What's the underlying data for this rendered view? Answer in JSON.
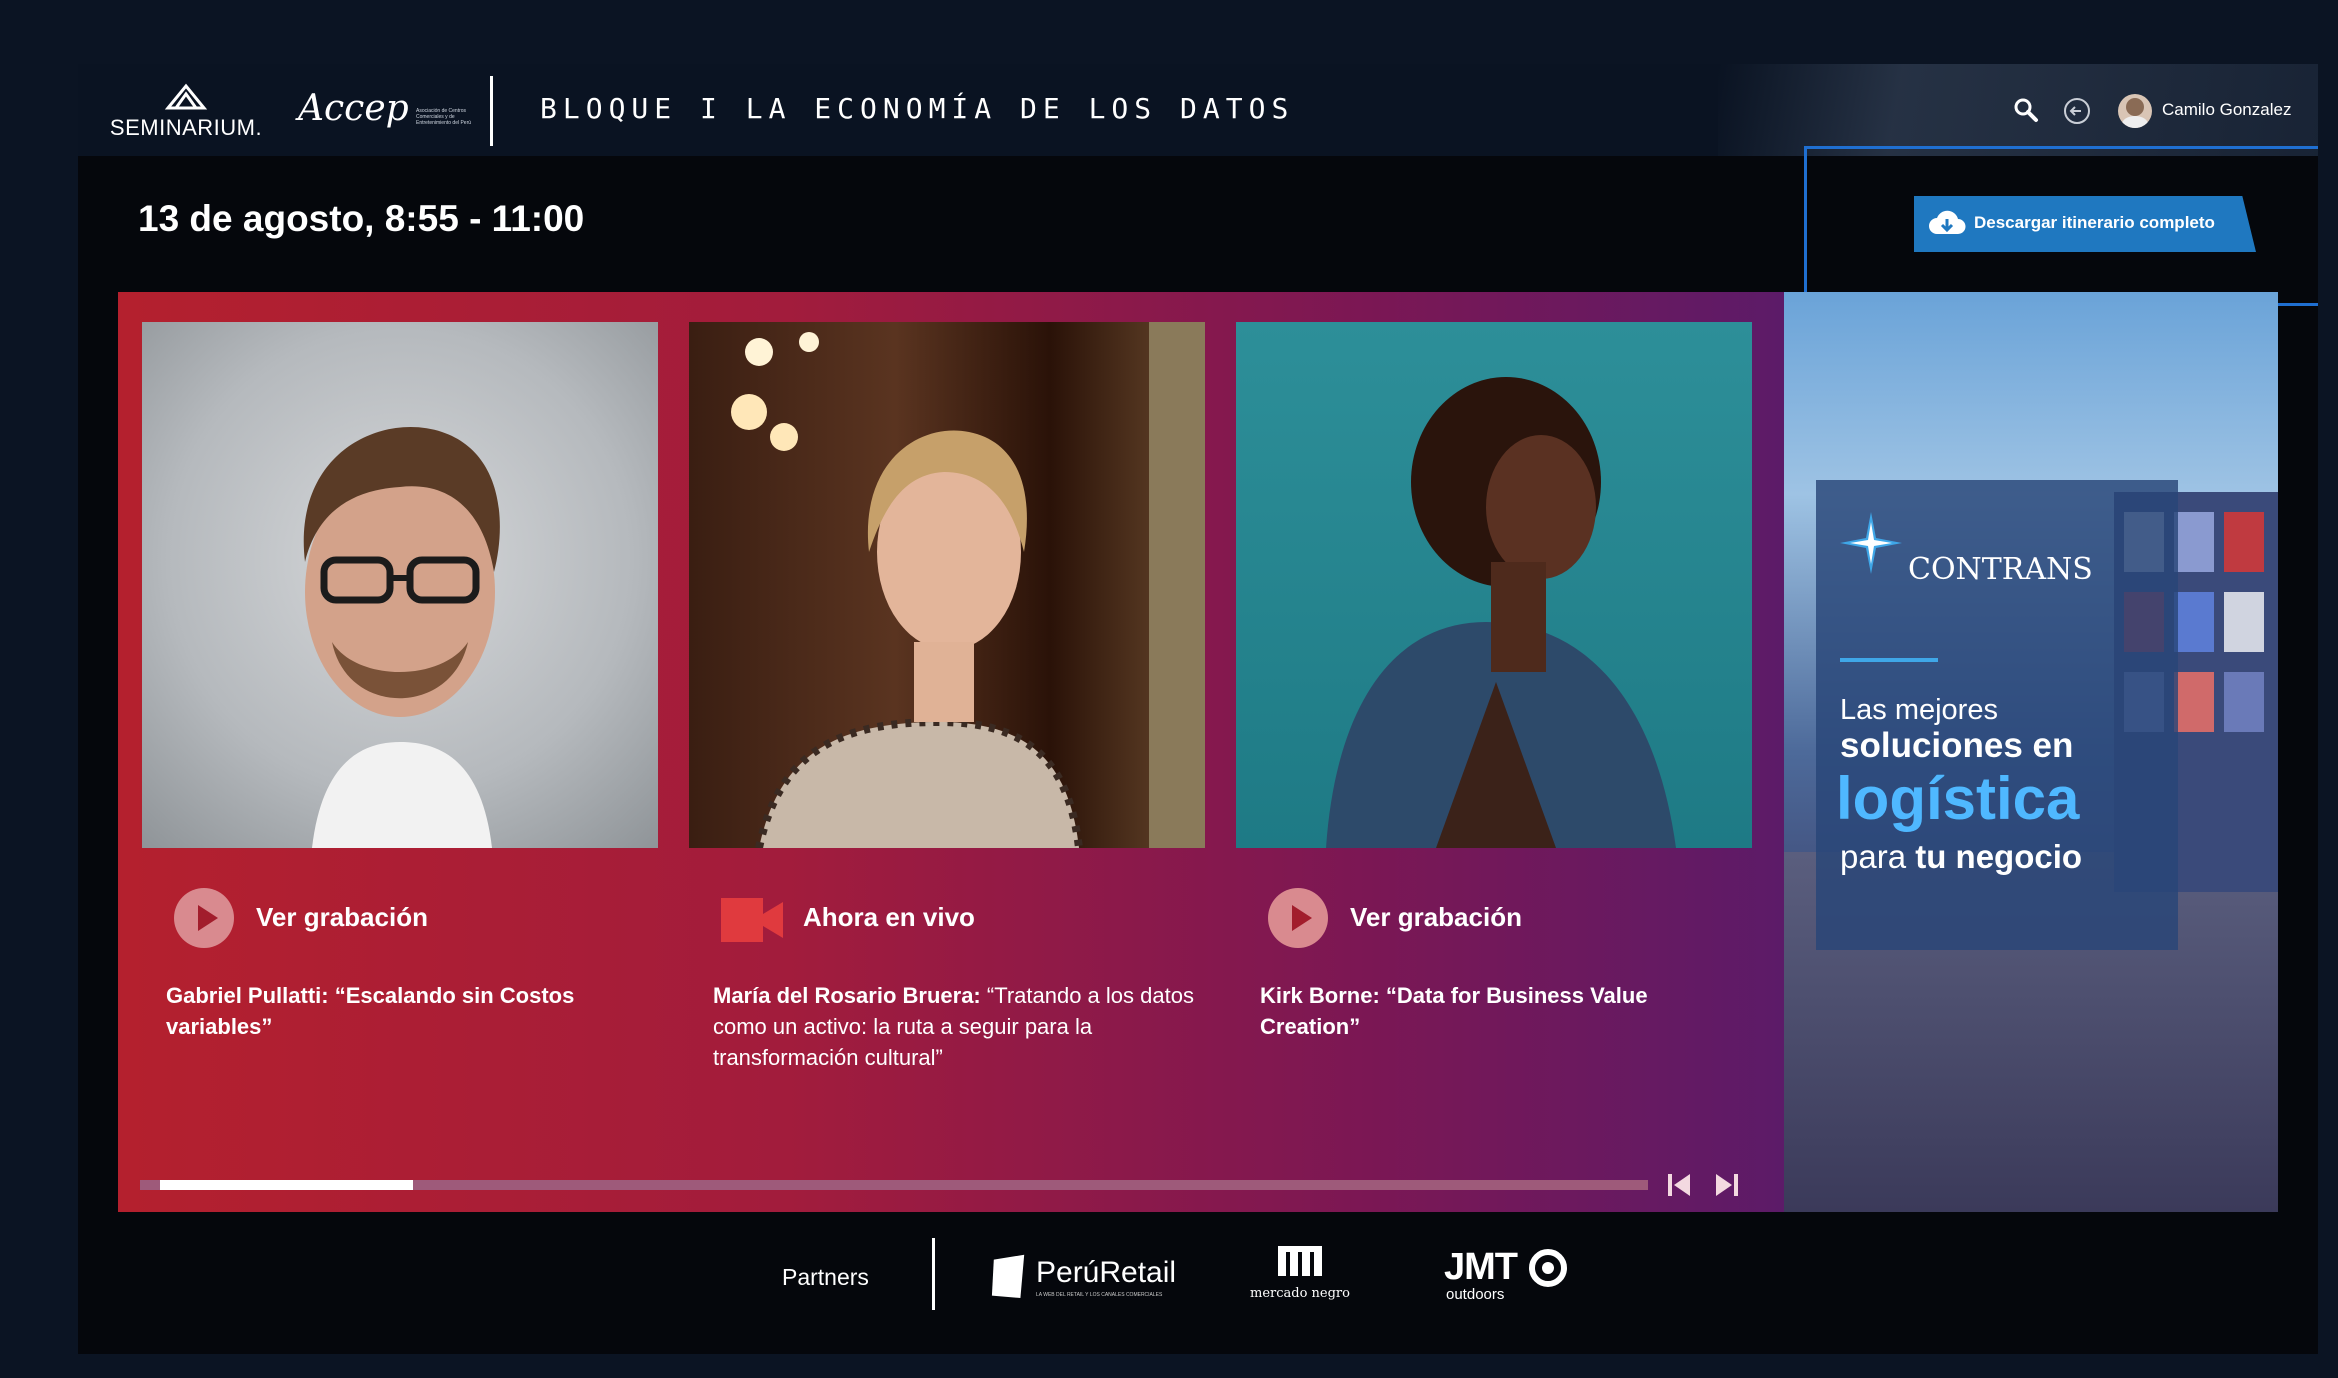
{
  "header": {
    "logo_seminarium": "SEMINARIUM.",
    "logo_accep": "Accep",
    "logo_accep_sub": "Asociación de Centros Comerciales y de Entretenimiento del Perú",
    "block_title": "BLOQUE I LA ECONOMÍA DE LOS DATOS",
    "user_name": "Camilo Gonzalez",
    "icons": [
      "search-icon",
      "logout-icon"
    ]
  },
  "schedule": {
    "date_label": "13 de agosto, 8:55 - 11:00",
    "download_label": "Descargar itinerario completo"
  },
  "sessions": [
    {
      "status_label": "Ver grabación",
      "status_icon": "play-icon",
      "speaker": "Gabriel Pullatti:",
      "talk": "“Escalando sin Costos variables”"
    },
    {
      "status_label": "Ahora en vivo",
      "status_icon": "video-camera-icon",
      "speaker": "María del Rosario Bruera:",
      "talk": "“Tratando a los datos como un activo: la ruta a seguir para la transformación cultural”"
    },
    {
      "status_label": "Ver grabación",
      "status_icon": "play-icon",
      "speaker": "Kirk Borne:",
      "talk": "“Data for Business Value Creation”"
    }
  ],
  "carousel": {
    "progress": 0.17
  },
  "ad": {
    "brand": "CONTRANS",
    "line1": "Las mejores",
    "line2": "soluciones en",
    "line3": "logística",
    "line4_a": "para",
    "line4_b": "tu negocio"
  },
  "partners": {
    "label": "Partners",
    "peru_retail": "PerúRetail",
    "peru_retail_tag": "LA WEB DEL RETAIL Y LOS CANALES COMERCIALES",
    "mercado_negro": "mercado negro",
    "jmt": "JMT",
    "jmt_sub": "outdoors"
  },
  "colors": {
    "accent_blue": "#1f78c0",
    "highlight_outline": "#1f6fd1",
    "panel_red": "#b4202e",
    "panel_purple": "#5c1b68"
  }
}
